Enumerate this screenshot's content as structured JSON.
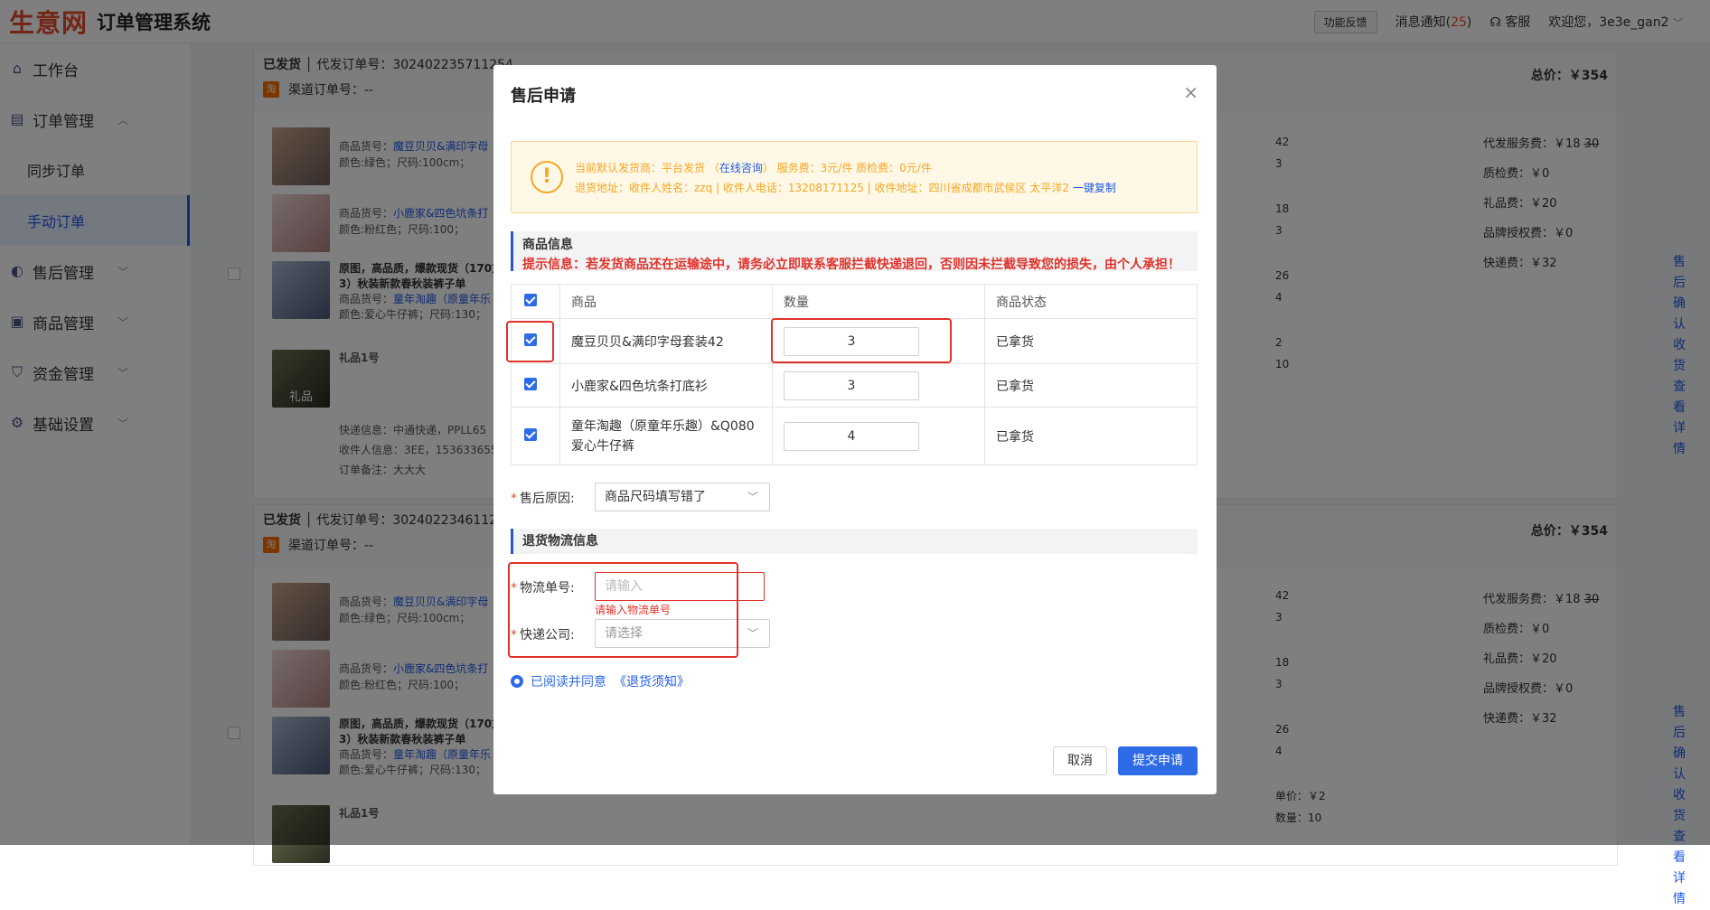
{
  "header": {
    "logo": "生意网",
    "title": "订单管理系统",
    "feedback": "功能反馈",
    "notice_label": "消息通知(",
    "notice_count": "25",
    "notice_close": ")",
    "service": "客服",
    "welcome": "欢迎您，3e3e_gan2"
  },
  "sidebar": {
    "workbench": "工作台",
    "order_mgmt": "订单管理",
    "sync": "同步订单",
    "manual": "手动订单",
    "aftersale": "售后管理",
    "goods": "商品管理",
    "funds": "资金管理",
    "settings": "基础设置"
  },
  "orders": [
    {
      "status": "已发货",
      "sub": "代发订单号：302402235711254",
      "channel": "渠道订单号：--",
      "total": "总价：￥354",
      "tao": "淘"
    },
    {
      "status": "已发货",
      "sub": "代发订单号：30240223461125",
      "channel": "渠道订单号：--",
      "total": "总价：￥354",
      "tao": "淘"
    }
  ],
  "bg_products": {
    "p1_code": "商品货号：",
    "p1_link": "魔豆贝贝&满印字母",
    "p1_attr": "颜色:绿色；尺码:100cm；",
    "p2_code": "商品货号：",
    "p2_link": "小鹿家&四色坑条打",
    "p2_attr": "颜色:粉红色；尺码:100；",
    "p3_title": "原图，高品质，爆款现货（170尨",
    "p3_title2": "3）秋装新款春秋装裤子单",
    "p3_code": "商品货号：",
    "p3_link": "童年淘趣（原童年乐",
    "p3_attr": "颜色:爱心牛仔裤；尺码:130；",
    "gift": "礼品1号",
    "gift_thumb": "礼品",
    "exp": "快递信息：中通快递，PPLL65",
    "recv": "收件人信息：3EE，1536336555",
    "note": "订单备注：大大大"
  },
  "bg_mid": {
    "a": "42",
    "b": "3",
    "c": "18",
    "d": "3",
    "e": "26",
    "f": "4",
    "g": "2",
    "h": "10",
    "unit": "单价：￥2",
    "count": "数量：10"
  },
  "bg_fees": {
    "svc": "代发服务费：￥18",
    "svc_old": "30",
    "qc": "质检费：￥0",
    "gift": "礼品费：￥20",
    "brand": "品牌授权费：￥0",
    "ship": "快递费：￥32"
  },
  "bg_actions": {
    "a": "售后",
    "b": "确认收货",
    "c": "查看详情"
  },
  "modal": {
    "title": "售后申请",
    "close": "×",
    "warn_line1_a": "当前默认发货商：",
    "warn_line1_b": "平台发货 （",
    "warn_line1_link": "在线咨询",
    "warn_line1_c": "） 服务费：3元/件 质检费：0元/件",
    "warn_line2_a": "退货地址：收件人姓名：zzq | 收件人电话：13208171125 | 收件地址：四川省成都市武侯区 太平洋2",
    "warn_line2_link": "一键复制",
    "goods_info": "商品信息",
    "tip": "提示信息：若发货商品还在运输途中，请务必立即联系客服拦截快递退回，否则因未拦截导致您的损失，由个人承担！",
    "cols": {
      "goods": "商品",
      "qty": "数量",
      "status": "商品状态"
    },
    "rows": [
      {
        "name": "魔豆贝贝&满印字母套装42",
        "qty": "3",
        "status": "已拿货"
      },
      {
        "name": "小鹿家&四色坑条打底衫",
        "qty": "3",
        "status": "已拿货"
      },
      {
        "name": "童年淘趣（原童年乐趣）&Q080",
        "name2": "爱心牛仔裤",
        "qty": "4",
        "status": "已拿货"
      }
    ],
    "reason_label": "售后原因:",
    "reason_value": "商品尺码填写错了",
    "logistics_head": "退货物流信息",
    "tracking_label": "物流单号:",
    "tracking_placeholder": "请输入",
    "tracking_error": "请输入物流单号",
    "company_label": "快递公司:",
    "company_placeholder": "请选择",
    "agree": "已阅读并同意",
    "agree_link": "《退货须知》",
    "cancel": "取消",
    "submit": "提交申请"
  },
  "colors": {
    "accent": "#2e6be6",
    "danger": "#e0322a",
    "warn": "#f5a623"
  }
}
